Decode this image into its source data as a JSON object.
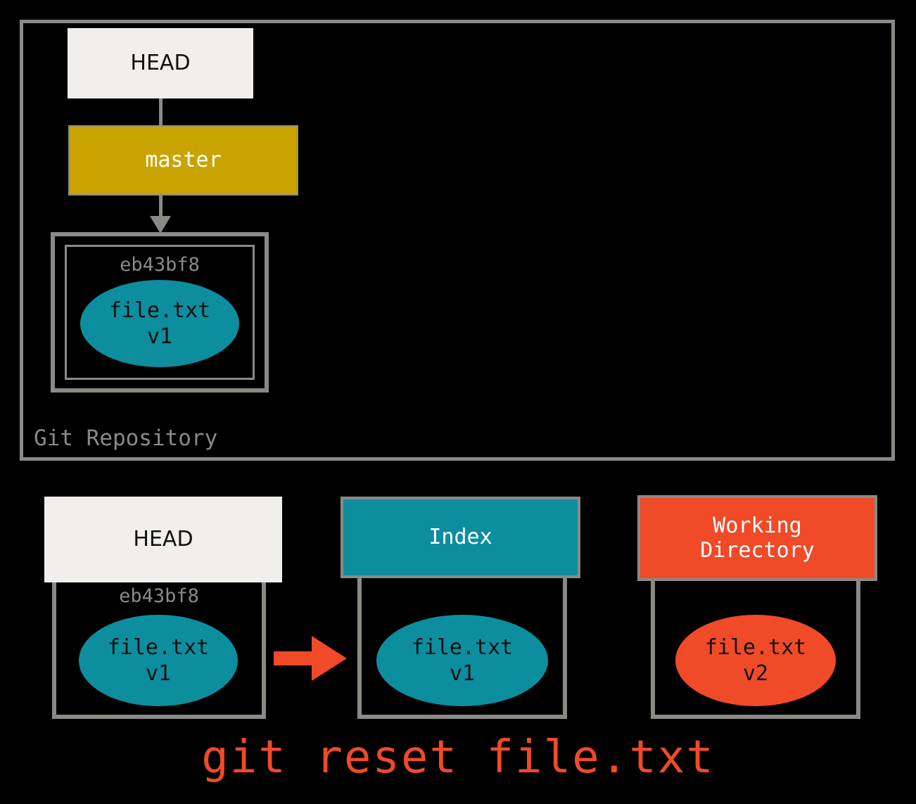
{
  "diagram": {
    "title_caption": "git reset file.txt",
    "colors": {
      "background": "#000000",
      "border_gray": "#8a8a85",
      "head_fill": "#f0efeb",
      "master_fill": "#c9a400",
      "teal": "#0d8e9e",
      "orange_red": "#f04a28",
      "hash_text": "#8a8a85"
    }
  },
  "repository": {
    "label": "Git Repository",
    "head": {
      "label": "HEAD"
    },
    "branch": {
      "label": "master"
    },
    "commit": {
      "hash": "eb43bf8",
      "blob": {
        "filename": "file.txt",
        "version": "v1"
      }
    }
  },
  "areas": {
    "head": {
      "title": "HEAD",
      "hash": "eb43bf8",
      "blob": {
        "filename": "file.txt",
        "version": "v1"
      }
    },
    "index": {
      "title": "Index",
      "blob": {
        "filename": "file.txt",
        "version": "v1"
      }
    },
    "working_directory": {
      "title_line1": "Working",
      "title_line2": "Directory",
      "blob": {
        "filename": "file.txt",
        "version": "v2"
      }
    }
  },
  "arrow": {
    "name": "head-to-index-arrow",
    "direction": "right",
    "color": "#f04a28"
  }
}
